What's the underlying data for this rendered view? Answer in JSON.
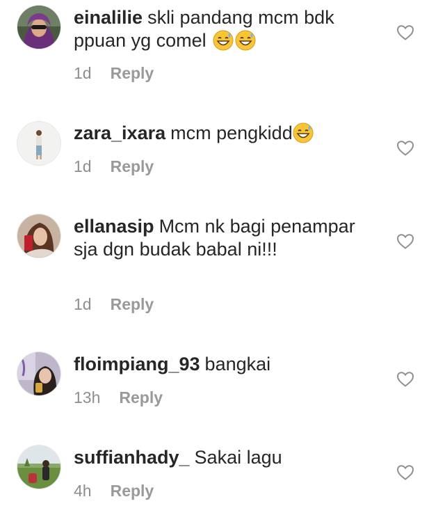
{
  "comments": [
    {
      "username": "einalilie",
      "text": "skli pandang mcm bdk ppuan yg comel",
      "emoji": [
        "sweat-smile-emoji",
        "sweat-smile-emoji"
      ],
      "time": "1d",
      "reply_label": "Reply",
      "avatar": "avatar-woman-hijab-sunglasses"
    },
    {
      "username": "zara_ixara",
      "text": "mcm pengkidd",
      "emoji": [
        "sweat-smile-emoji"
      ],
      "time": "1d",
      "reply_label": "Reply",
      "avatar": "avatar-standing-figure"
    },
    {
      "username": "ellanasip",
      "text": "Mcm nk bagi penampar sja dgn budak babal ni!!!",
      "emoji": [],
      "time": "1d",
      "reply_label": "Reply",
      "avatar": "avatar-woman-red-phone"
    },
    {
      "username": "floimpiang_93",
      "text": "bangkai",
      "emoji": [],
      "time": "13h",
      "reply_label": "Reply",
      "avatar": "avatar-woman-selfie"
    },
    {
      "username": "suffianhady_",
      "text": "Sakai lagu",
      "emoji": [],
      "time": "4h",
      "reply_label": "Reply",
      "avatar": "avatar-outdoor-field"
    }
  ],
  "colors": {
    "text": "#262626",
    "secondary": "#8e8e8e",
    "heart_outline": "#8e8e8e"
  }
}
